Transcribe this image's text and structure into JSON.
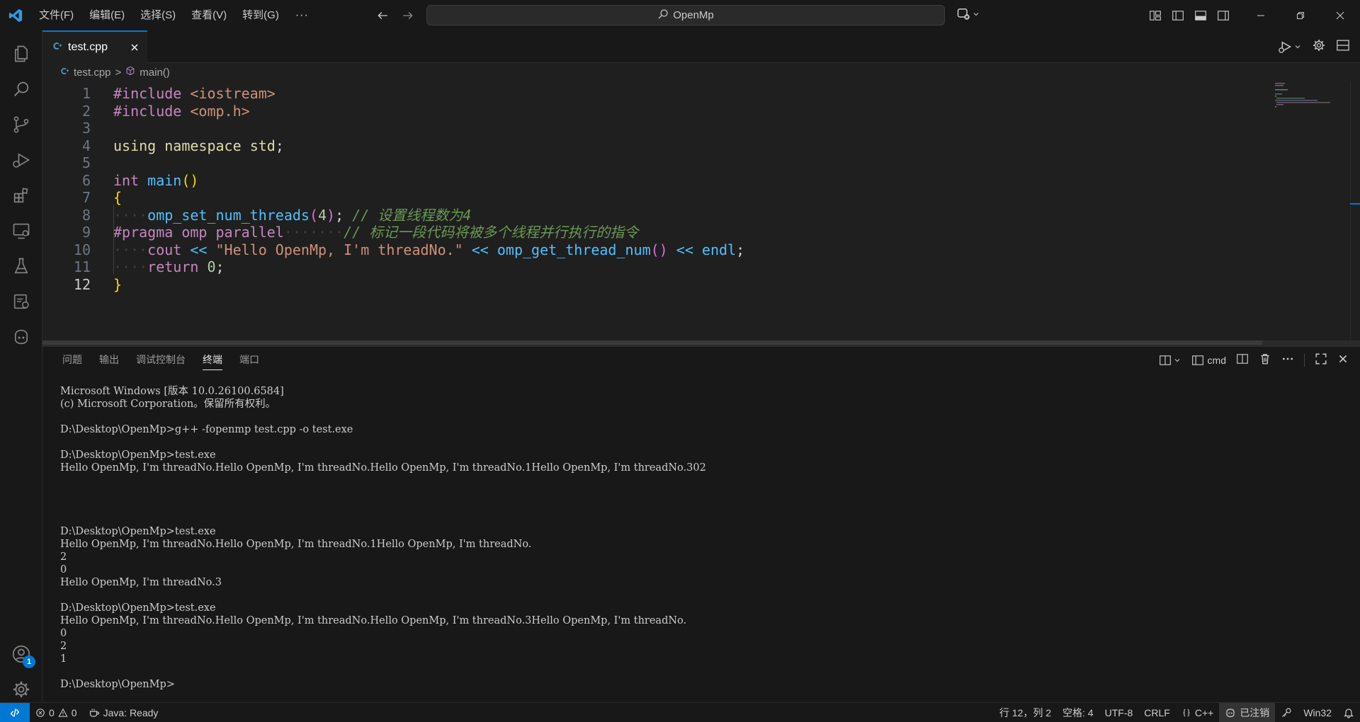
{
  "titlebar": {
    "menu": [
      "文件(F)",
      "编辑(E)",
      "选择(S)",
      "查看(V)",
      "转到(G)"
    ],
    "more": "···",
    "search_text": "OpenMp"
  },
  "tabs": [
    {
      "label": "test.cpp"
    }
  ],
  "breadcrumb": {
    "file": "test.cpp",
    "separator": ">",
    "symbol": "main()"
  },
  "editor": {
    "line_numbers": [
      "1",
      "2",
      "3",
      "4",
      "5",
      "6",
      "7",
      "8",
      "9",
      "10",
      "11",
      "12"
    ],
    "active_line": "12",
    "lines": [
      [
        {
          "t": "#include",
          "c": "tok-kw"
        },
        {
          "t": " ",
          "c": "tok-plain"
        },
        {
          "t": "<iostream>",
          "c": "tok-incpath"
        }
      ],
      [
        {
          "t": "#include",
          "c": "tok-kw"
        },
        {
          "t": " ",
          "c": "tok-plain"
        },
        {
          "t": "<omp.h>",
          "c": "tok-incpath"
        }
      ],
      [],
      [
        {
          "t": "using",
          "c": "tok-yellow"
        },
        {
          "t": " ",
          "c": "tok-plain"
        },
        {
          "t": "namespace",
          "c": "tok-yellow"
        },
        {
          "t": " ",
          "c": "tok-plain"
        },
        {
          "t": "std",
          "c": "tok-yellow"
        },
        {
          "t": ";",
          "c": "tok-plain"
        }
      ],
      [],
      [
        {
          "t": "int",
          "c": "tok-kw"
        },
        {
          "t": " ",
          "c": "tok-plain"
        },
        {
          "t": "main",
          "c": "tok-fn2"
        },
        {
          "t": "()",
          "c": "tok-brace"
        }
      ],
      [
        {
          "t": "{",
          "c": "tok-brace"
        }
      ],
      [
        {
          "t": "····",
          "c": "tok-ws"
        },
        {
          "t": "omp_set_num_threads",
          "c": "tok-fn2"
        },
        {
          "t": "(",
          "c": "tok-brace2"
        },
        {
          "t": "4",
          "c": "tok-num"
        },
        {
          "t": ")",
          "c": "tok-brace2"
        },
        {
          "t": "; ",
          "c": "tok-plain"
        },
        {
          "t": "// 设置线程数为4",
          "c": "tok-comment"
        }
      ],
      [
        {
          "t": "#pragma omp parallel",
          "c": "tok-pragma"
        },
        {
          "t": "·······",
          "c": "tok-ws"
        },
        {
          "t": "// 标记一段代码将被多个线程并行执行的指令",
          "c": "tok-comment"
        }
      ],
      [
        {
          "t": "····",
          "c": "tok-ws"
        },
        {
          "t": "cout",
          "c": "tok-kw"
        },
        {
          "t": " << ",
          "c": "tok-fn2"
        },
        {
          "t": "\"Hello OpenMp, I'm threadNo.\"",
          "c": "tok-str"
        },
        {
          "t": " << ",
          "c": "tok-fn2"
        },
        {
          "t": "omp_get_thread_num",
          "c": "tok-fn2"
        },
        {
          "t": "()",
          "c": "tok-brace2"
        },
        {
          "t": " << ",
          "c": "tok-fn2"
        },
        {
          "t": "endl",
          "c": "tok-fn2"
        },
        {
          "t": ";",
          "c": "tok-plain"
        }
      ],
      [
        {
          "t": "····",
          "c": "tok-ws"
        },
        {
          "t": "return",
          "c": "tok-kw"
        },
        {
          "t": " ",
          "c": "tok-plain"
        },
        {
          "t": "0",
          "c": "tok-num"
        },
        {
          "t": ";",
          "c": "tok-plain"
        }
      ],
      [
        {
          "t": "}",
          "c": "tok-brace"
        }
      ]
    ]
  },
  "panel": {
    "tabs": [
      "问题",
      "输出",
      "调试控制台",
      "终端",
      "端口"
    ],
    "active_tab": "终端",
    "terminal_profile": "cmd",
    "terminal_lines": [
      "Microsoft Windows [版本 10.0.26100.6584]",
      "(c) Microsoft Corporation。保留所有权利。",
      "",
      "D:\\Desktop\\OpenMp>g++ -fopenmp test.cpp -o test.exe",
      "",
      "D:\\Desktop\\OpenMp>test.exe",
      "Hello OpenMp, I'm threadNo.Hello OpenMp, I'm threadNo.Hello OpenMp, I'm threadNo.1Hello OpenMp, I'm threadNo.302",
      "",
      "",
      "",
      "",
      "D:\\Desktop\\OpenMp>test.exe",
      "Hello OpenMp, I'm threadNo.Hello OpenMp, I'm threadNo.1Hello OpenMp, I'm threadNo.",
      "2",
      "0",
      "Hello OpenMp, I'm threadNo.3",
      "",
      "D:\\Desktop\\OpenMp>test.exe",
      "Hello OpenMp, I'm threadNo.Hello OpenMp, I'm threadNo.Hello OpenMp, I'm threadNo.3Hello OpenMp, I'm threadNo.",
      "0",
      "2",
      "1",
      "",
      "D:\\Desktop\\OpenMp>"
    ]
  },
  "activitybar": {
    "account_badge": "1"
  },
  "statusbar": {
    "errors": "0",
    "warnings": "0",
    "java": "Java: Ready",
    "position": "行 12，列 2",
    "spaces": "空格: 4",
    "encoding": "UTF-8",
    "eol": "CRLF",
    "language": "C++",
    "account": "已注销",
    "platform": "Win32"
  },
  "colors": {
    "accent": "#0078d4",
    "background": "#1f1f1f",
    "chrome": "#181818"
  }
}
